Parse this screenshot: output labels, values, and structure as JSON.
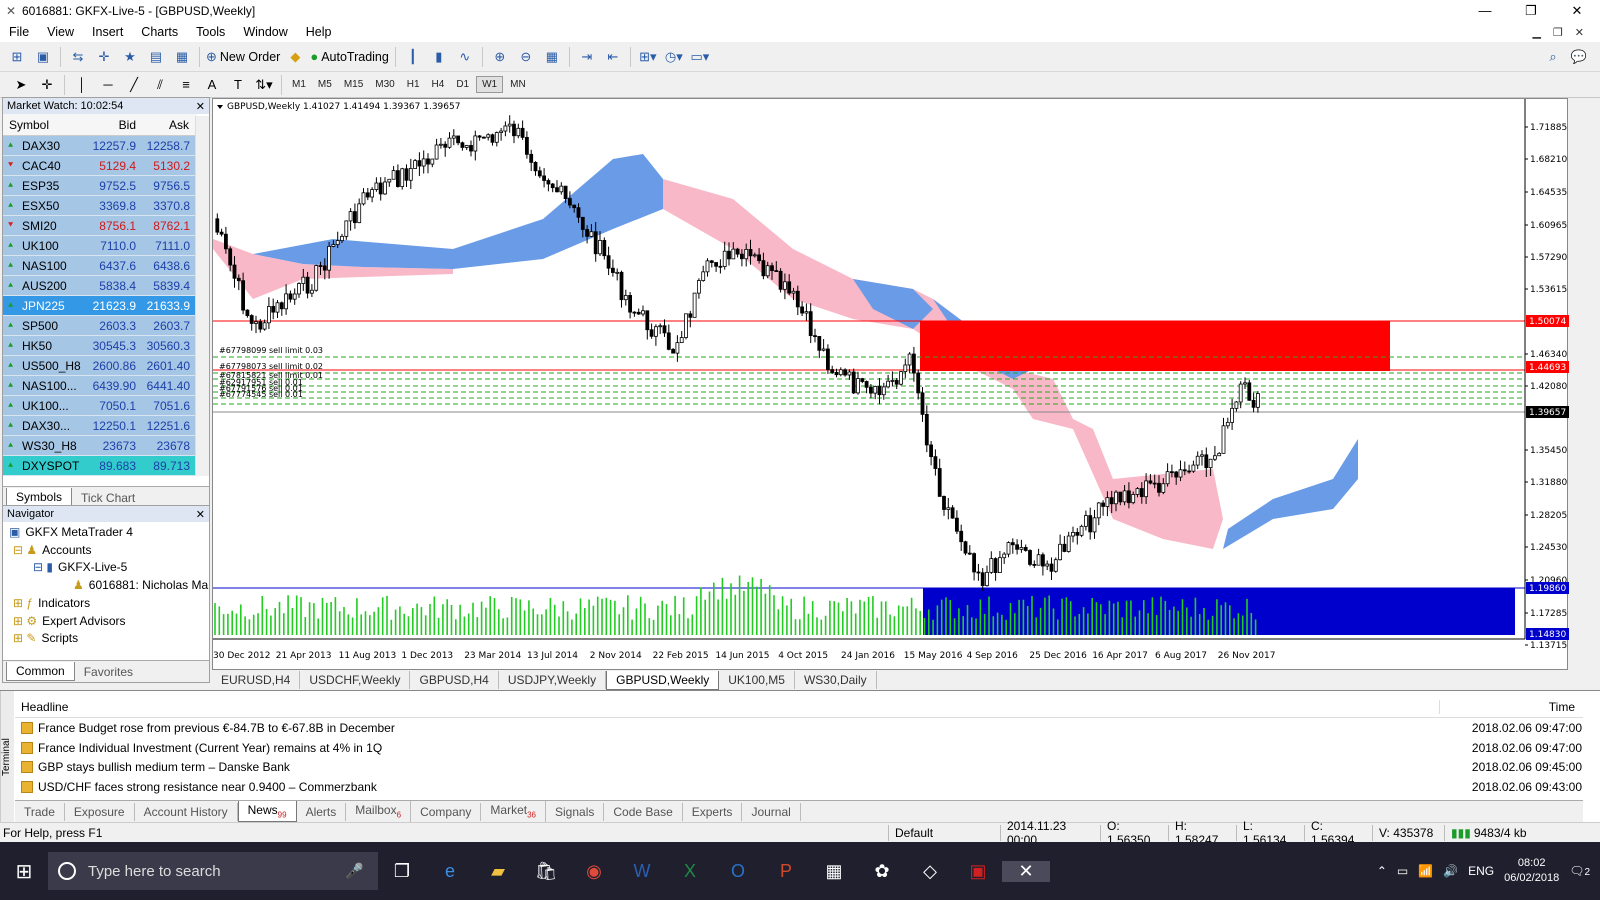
{
  "title": "6016881: GKFX-Live-5 - [GBPUSD,Weekly]",
  "window_controls": [
    "—",
    "❐",
    "✕"
  ],
  "menu": [
    "File",
    "View",
    "Insert",
    "Charts",
    "Tools",
    "Window",
    "Help"
  ],
  "toolbar": {
    "new_order": "New Order",
    "autotrading": "AutoTrading"
  },
  "timeframes": [
    "M1",
    "M5",
    "M15",
    "M30",
    "H1",
    "H4",
    "D1",
    "W1",
    "MN"
  ],
  "active_timeframe": "W1",
  "market_watch": {
    "title": "Market Watch: 10:02:54",
    "cols": [
      "Symbol",
      "Bid",
      "Ask"
    ],
    "rows": [
      {
        "symbol": "DAX30",
        "bid": "12257.9",
        "ask": "12258.7",
        "dir": "up"
      },
      {
        "symbol": "CAC40",
        "bid": "5129.4",
        "ask": "5130.2",
        "dir": "down"
      },
      {
        "symbol": "ESP35",
        "bid": "9752.5",
        "ask": "9756.5",
        "dir": "up"
      },
      {
        "symbol": "ESX50",
        "bid": "3369.8",
        "ask": "3370.8",
        "dir": "up"
      },
      {
        "symbol": "SMI20",
        "bid": "8756.1",
        "ask": "8762.1",
        "dir": "down"
      },
      {
        "symbol": "UK100",
        "bid": "7110.0",
        "ask": "7111.0",
        "dir": "up"
      },
      {
        "symbol": "NAS100",
        "bid": "6437.6",
        "ask": "6438.6",
        "dir": "up"
      },
      {
        "symbol": "AUS200",
        "bid": "5838.4",
        "ask": "5839.4",
        "dir": "up"
      },
      {
        "symbol": "JPN225",
        "bid": "21623.9",
        "ask": "21633.9",
        "dir": "up",
        "selected": true
      },
      {
        "symbol": "SP500",
        "bid": "2603.3",
        "ask": "2603.7",
        "dir": "up"
      },
      {
        "symbol": "HK50",
        "bid": "30545.3",
        "ask": "30560.3",
        "dir": "up"
      },
      {
        "symbol": "US500_H8",
        "bid": "2600.86",
        "ask": "2601.40",
        "dir": "up"
      },
      {
        "symbol": "NAS100...",
        "bid": "6439.90",
        "ask": "6441.40",
        "dir": "up"
      },
      {
        "symbol": "UK100...",
        "bid": "7050.1",
        "ask": "7051.6",
        "dir": "up"
      },
      {
        "symbol": "DAX30...",
        "bid": "12250.1",
        "ask": "12251.6",
        "dir": "up"
      },
      {
        "symbol": "WS30_H8",
        "bid": "23673",
        "ask": "23678",
        "dir": "up"
      },
      {
        "symbol": "DXYSPOT",
        "bid": "89.683",
        "ask": "89.713",
        "dir": "up",
        "special": true
      }
    ],
    "tabs": [
      "Symbols",
      "Tick Chart"
    ]
  },
  "navigator": {
    "title": "Navigator",
    "items": [
      "GKFX MetaTrader 4",
      "Accounts",
      "GKFX-Live-5",
      "6016881: Nicholas Ma",
      "Indicators",
      "Expert Advisors",
      "Scripts"
    ],
    "tabs": [
      "Common",
      "Favorites"
    ]
  },
  "chart": {
    "header": "GBPUSD,Weekly  1.41027 1.41494 1.39367 1.39657",
    "price_labels": [
      "1.71885",
      "1.68210",
      "1.64535",
      "1.60965",
      "1.57290",
      "1.53615",
      "1.46340",
      "1.42080",
      "1.35450",
      "1.31880",
      "1.28205",
      "1.24530",
      "1.20960",
      "1.17285",
      "1.13715"
    ],
    "price_tags": {
      "red_high": "1.50074",
      "red_low": "1.44693",
      "current": "1.39657",
      "blue_high": "1.19860",
      "blue_low": "1.14830"
    },
    "order_labels": [
      "#67798099 sell limit 0.03",
      "#67798073 sell limit 0.02",
      "#67815821 sell limit 0.01",
      "#62917951 sell 0.01",
      "#67791576 sell 0.01",
      "#67774545 sell 0.01"
    ],
    "date_labels": [
      "30 Dec 2012",
      "21 Apr 2013",
      "11 Aug 2013",
      "1 Dec 2013",
      "23 Mar 2014",
      "13 Jul 2014",
      "2 Nov 2014",
      "22 Feb 2015",
      "14 Jun 2015",
      "4 Oct 2015",
      "24 Jan 2016",
      "15 May 2016",
      "4 Sep 2016",
      "25 Dec 2016",
      "16 Apr 2017",
      "6 Aug 2017",
      "26 Nov 2017"
    ],
    "colors": {
      "bull_cloud": "#6a9be6",
      "bear_cloud": "#f8b8c8",
      "red_zone": "#ff0000",
      "blue_zone": "#0000cc",
      "volume": "#22cc22"
    }
  },
  "chart_tabs": [
    "EURUSD,H4",
    "USDCHF,Weekly",
    "GBPUSD,H4",
    "USDJPY,Weekly",
    "GBPUSD,Weekly",
    "UK100,M5",
    "WS30,Daily"
  ],
  "active_chart_tab": "GBPUSD,Weekly",
  "terminal": {
    "side_label": "Terminal",
    "headline_col": "Headline",
    "time_col": "Time",
    "news": [
      {
        "headline": "France Budget rose from previous €-84.7B to €-67.8B in December",
        "time": "2018.02.06 09:47:00"
      },
      {
        "headline": "France Individual Investment (Current Year) remains at 4% in 1Q",
        "time": "2018.02.06 09:47:00"
      },
      {
        "headline": "GBP stays bullish medium term – Danske Bank",
        "time": "2018.02.06 09:45:00"
      },
      {
        "headline": "USD/CHF faces strong resistance near 0.9400 – Commerzbank",
        "time": "2018.02.06 09:43:00"
      }
    ],
    "tabs": [
      {
        "label": "Trade",
        "badge": ""
      },
      {
        "label": "Exposure",
        "badge": ""
      },
      {
        "label": "Account History",
        "badge": ""
      },
      {
        "label": "News",
        "badge": "99"
      },
      {
        "label": "Alerts",
        "badge": ""
      },
      {
        "label": "Mailbox",
        "badge": "6"
      },
      {
        "label": "Company",
        "badge": ""
      },
      {
        "label": "Market",
        "badge": "36"
      },
      {
        "label": "Signals",
        "badge": ""
      },
      {
        "label": "Code Base",
        "badge": ""
      },
      {
        "label": "Experts",
        "badge": ""
      },
      {
        "label": "Journal",
        "badge": ""
      }
    ]
  },
  "status": {
    "help": "For Help, press F1",
    "profile": "Default",
    "datetime": "2014.11.23 00:00",
    "open": "O: 1.56350",
    "high": "H: 1.58247",
    "low": "L: 1.56134",
    "close": "C: 1.56394",
    "volume": "V: 435378",
    "traffic": "9483/4 kb"
  },
  "taskbar": {
    "search_placeholder": "Type here to search",
    "lang": "ENG",
    "time": "08:02",
    "date": "06/02/2018",
    "notif": "2"
  }
}
